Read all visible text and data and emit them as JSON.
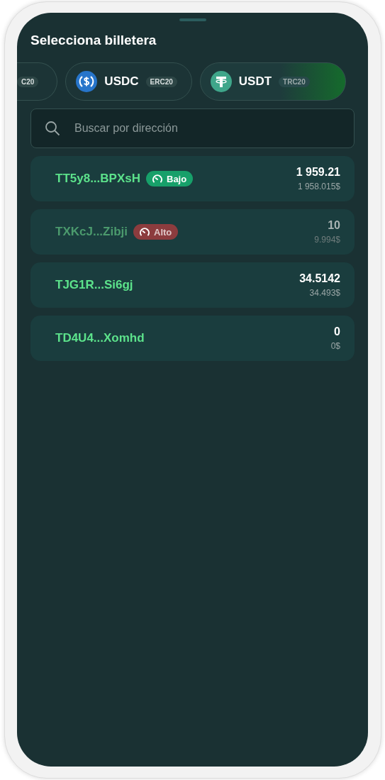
{
  "title": "Selecciona billetera",
  "tokens": [
    {
      "network": "C20",
      "selected": false,
      "cut": true
    },
    {
      "name": "USDC",
      "network": "ERC20",
      "kind": "usdc",
      "selected": false
    },
    {
      "name": "USDT",
      "network": "TRC20",
      "kind": "usdt",
      "selected": true
    }
  ],
  "search": {
    "placeholder": "Buscar por dirección"
  },
  "wallets": [
    {
      "address": "TT5y8...BPXsH",
      "risk": {
        "kind": "low",
        "label": "Bajo"
      },
      "amount": "1 959.21",
      "fiat": "1 958.015$",
      "disabled": false
    },
    {
      "address": "TXKcJ...Zibji",
      "risk": {
        "kind": "high",
        "label": "Alto"
      },
      "amount": "10",
      "fiat": "9.994$",
      "disabled": true
    },
    {
      "address": "TJG1R...Si6gj",
      "amount": "34.5142",
      "fiat": "34.493$",
      "disabled": false
    },
    {
      "address": "TD4U4...Xomhd",
      "amount": "0",
      "fiat": "0$",
      "disabled": false
    }
  ]
}
